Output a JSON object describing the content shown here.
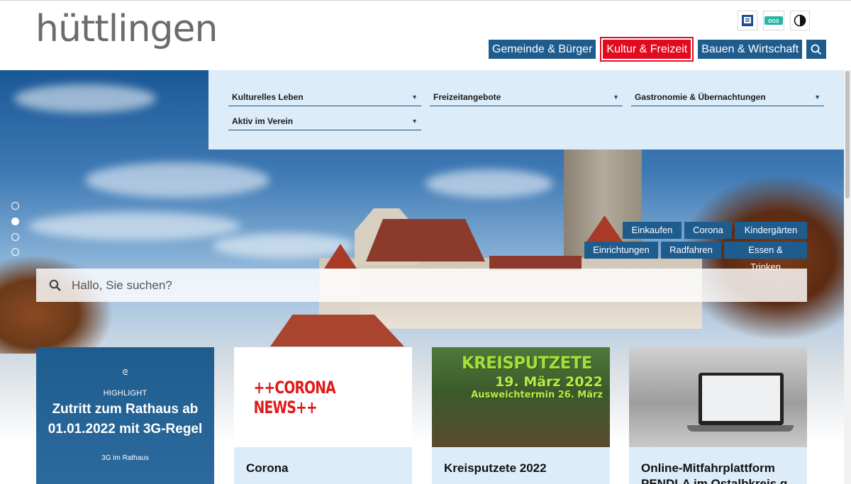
{
  "brand": {
    "logo_text": "hüttlingen"
  },
  "utility": {
    "items": [
      {
        "icon": "easy-language-icon"
      },
      {
        "icon": "sign-language-dgs-icon",
        "label": "DGS"
      },
      {
        "icon": "contrast-icon"
      }
    ]
  },
  "nav": {
    "items": [
      {
        "label": "Gemeinde & Bürger"
      },
      {
        "label": "Kultur & Freizeit",
        "active": true
      },
      {
        "label": "Bauen & Wirtschaft"
      }
    ],
    "search_icon": "search-icon"
  },
  "submenu": {
    "fields": [
      {
        "label": "Kulturelles Leben"
      },
      {
        "label": "Freizeitangebote"
      },
      {
        "label": "Gastronomie & Übernachtungen"
      },
      {
        "label": "Aktiv im Verein"
      }
    ]
  },
  "slider": {
    "slides": 4,
    "active_index": 1
  },
  "quick_links": [
    {
      "label": "Einkaufen"
    },
    {
      "label": "Corona"
    },
    {
      "label": "Kindergärten"
    },
    {
      "label": "Einrichtungen"
    },
    {
      "label": "Radfahren"
    },
    {
      "label": "Essen & Trinken"
    }
  ],
  "search": {
    "placeholder": "Hallo, Sie suchen?"
  },
  "cards": {
    "highlight": {
      "label": "HIGHLIGHT",
      "title": "Zutritt zum Rathaus ab 01.01.2022 mit 3G-Regel",
      "subtitle": "3G im Rathaus"
    },
    "corona": {
      "image_text": "++CORONA NEWS++",
      "title": "Corona"
    },
    "kreis": {
      "image_title": "KREISPUTZETE",
      "image_date": "19. März 2022",
      "image_alt": "Ausweichtermin 26. März",
      "title": "Kreisputzete 2022"
    },
    "mitfahr": {
      "title": "Online-Mitfahrplattform PENDLA im Ostalbkreis g"
    }
  },
  "colors": {
    "nav_blue": "#1f5c8e",
    "active_red": "#e10b1f",
    "panel_light_blue": "#dcedf9"
  }
}
